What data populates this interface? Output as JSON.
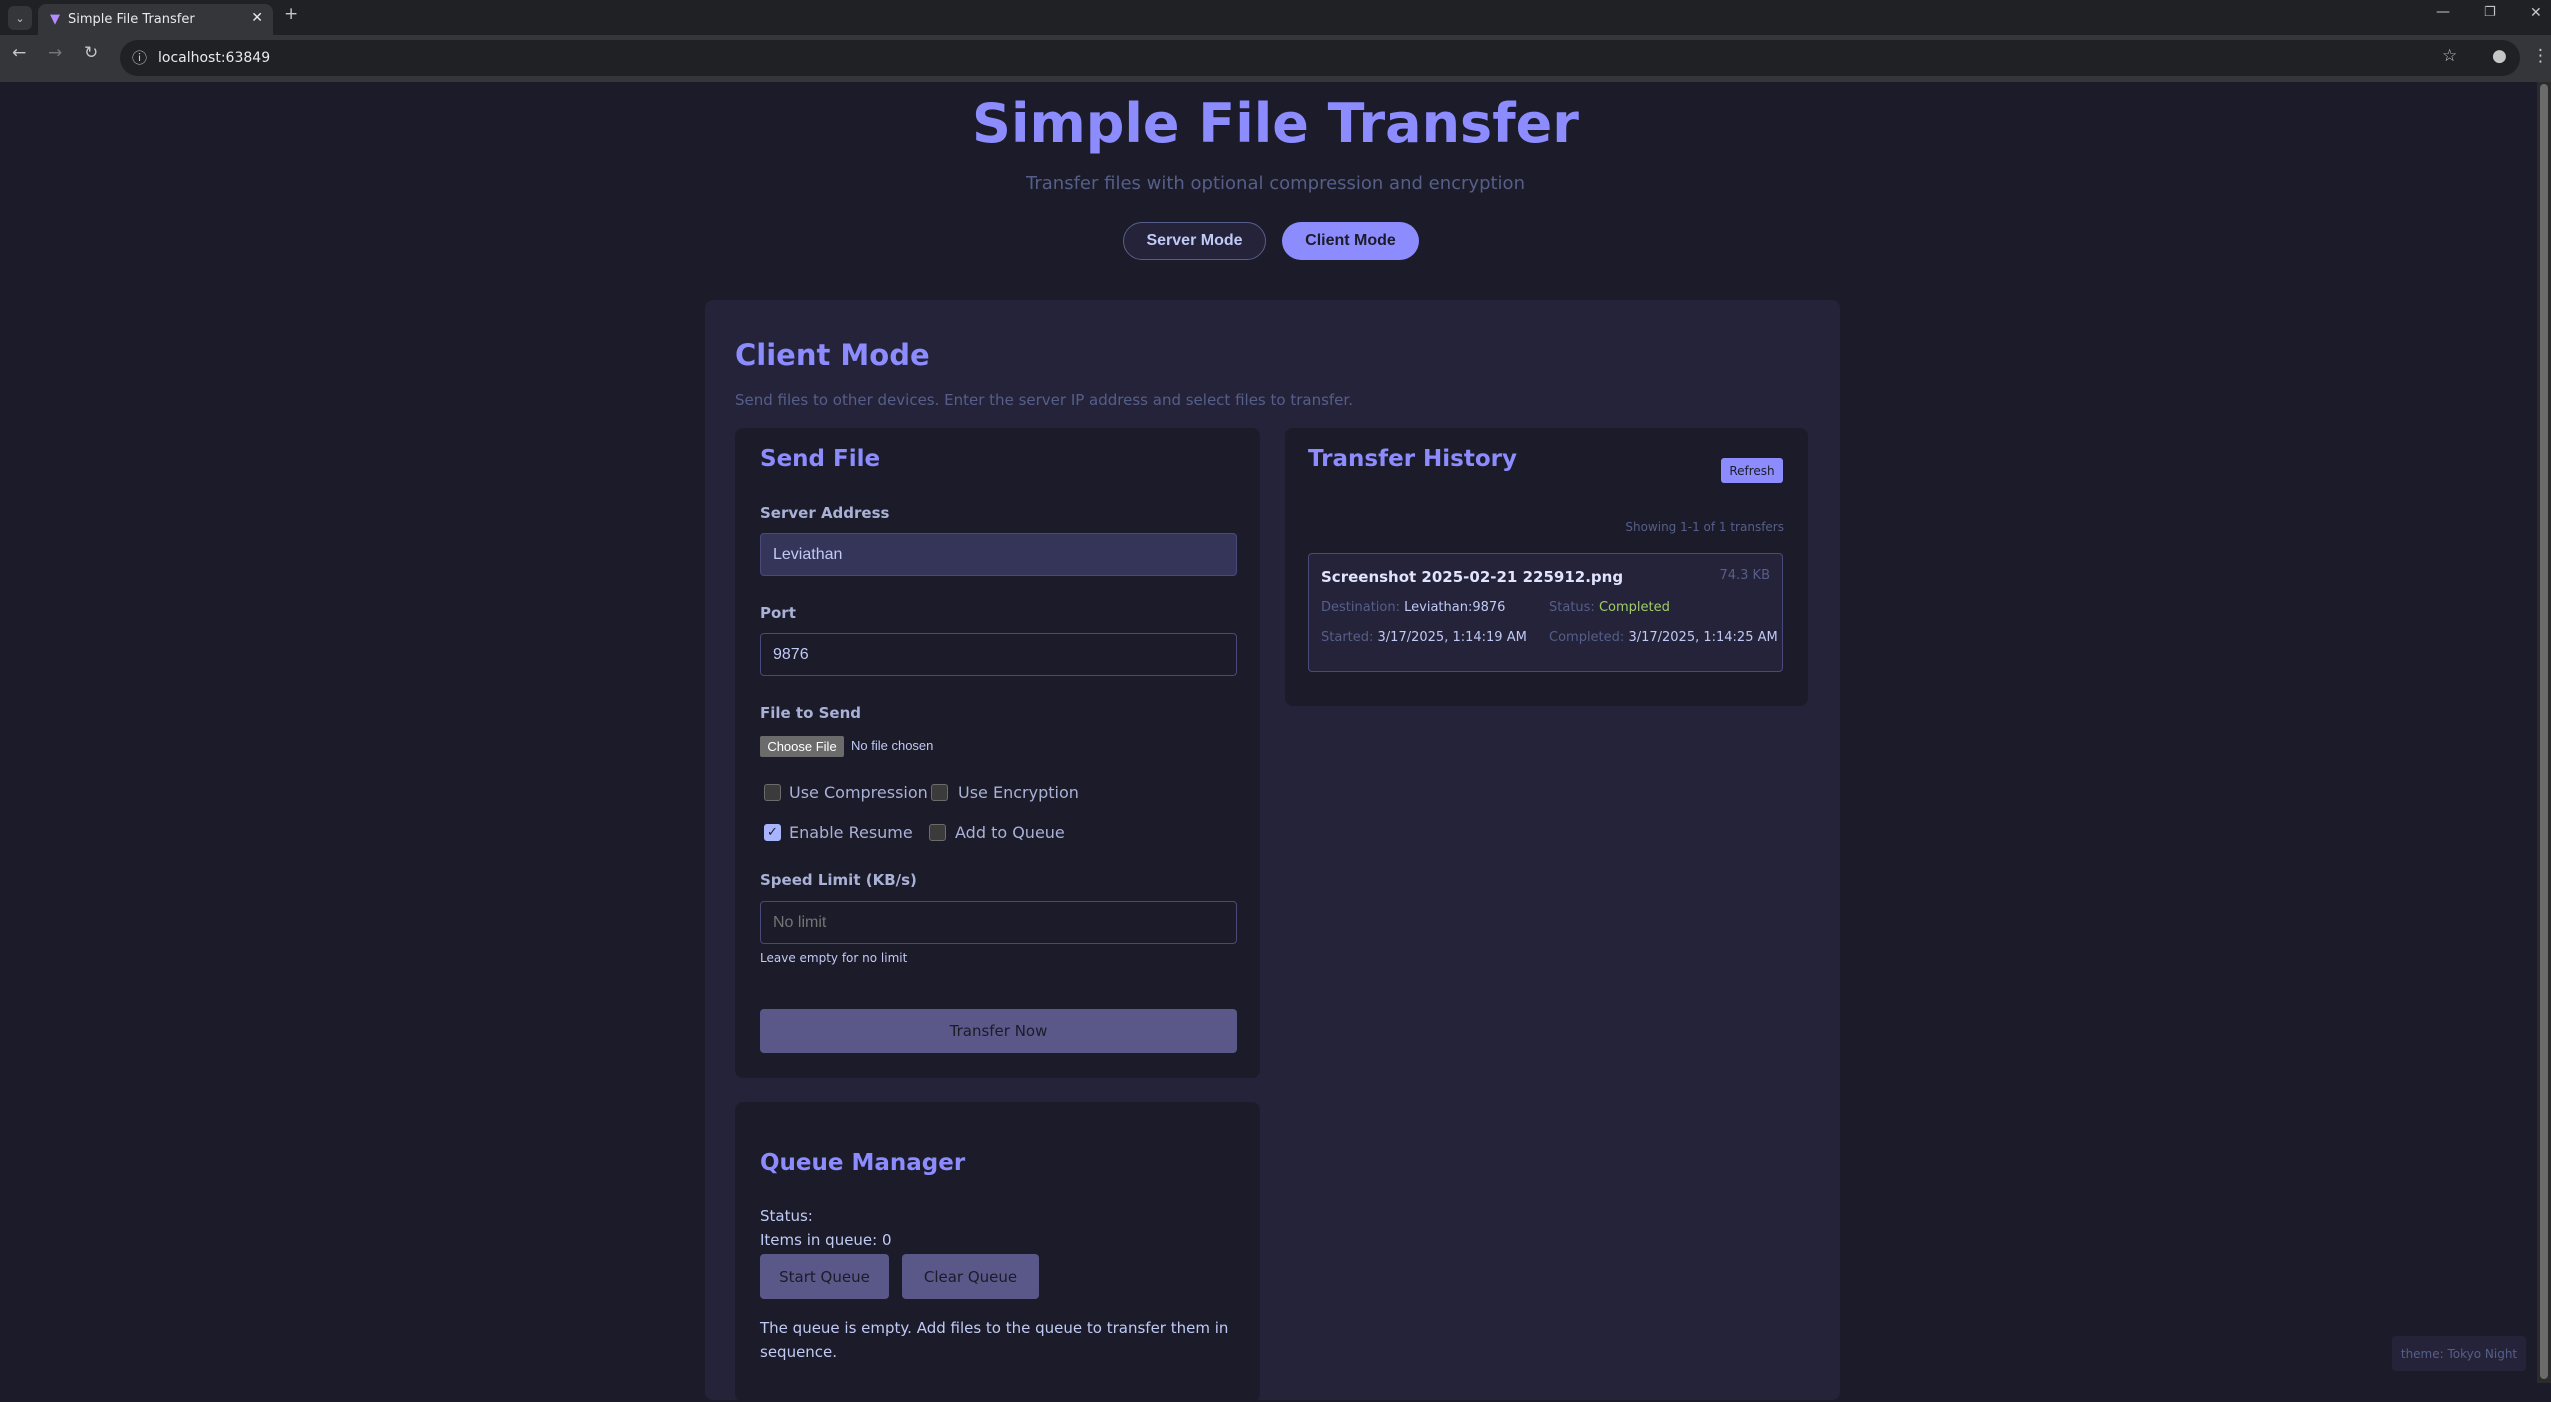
{
  "browser": {
    "tab_title": "Simple File Transfer",
    "url": "localhost:63849"
  },
  "header": {
    "title": "Simple File Transfer",
    "subtitle": "Transfer files with optional compression and encryption",
    "server_mode": "Server Mode",
    "client_mode": "Client Mode"
  },
  "client": {
    "title": "Client Mode",
    "description": "Send files to other devices. Enter the server IP address and select files to transfer."
  },
  "send": {
    "title": "Send File",
    "server_label": "Server Address",
    "server_value": "Leviathan",
    "port_label": "Port",
    "port_value": "9876",
    "file_label": "File to Send",
    "choose_file": "Choose File",
    "no_file": "No file chosen",
    "options": [
      {
        "label": "Use Compression",
        "checked": false
      },
      {
        "label": "Use Encryption",
        "checked": false
      },
      {
        "label": "Enable Resume",
        "checked": true
      },
      {
        "label": "Add to Queue",
        "checked": false
      }
    ],
    "speed_label": "Speed Limit (KB/s)",
    "speed_placeholder": "No limit",
    "speed_hint": "Leave empty for no limit",
    "submit": "Transfer Now"
  },
  "history": {
    "title": "Transfer History",
    "refresh": "Refresh",
    "showing": "Showing 1-1 of 1 transfers",
    "items": [
      {
        "name": "Screenshot 2025-02-21 225912.png",
        "size": "74.3 KB",
        "dest_label": "Destination:",
        "dest": "Leviathan:9876",
        "status_label": "Status:",
        "status": "Completed",
        "started_label": "Started:",
        "started": "3/17/2025, 1:14:19 AM",
        "completed_label": "Completed:",
        "completed": "3/17/2025, 1:14:25 AM"
      }
    ]
  },
  "queue": {
    "title": "Queue Manager",
    "status": "Status:",
    "items": "Items in queue: 0",
    "start": "Start Queue",
    "clear": "Clear Queue",
    "empty": "The queue is empty. Add files to the queue to transfer them in sequence."
  },
  "theme": "theme: Tokyo Night",
  "colors": {
    "accent": "#8c8cff",
    "success": "#9ece6a",
    "bg": "#1b1b29"
  }
}
